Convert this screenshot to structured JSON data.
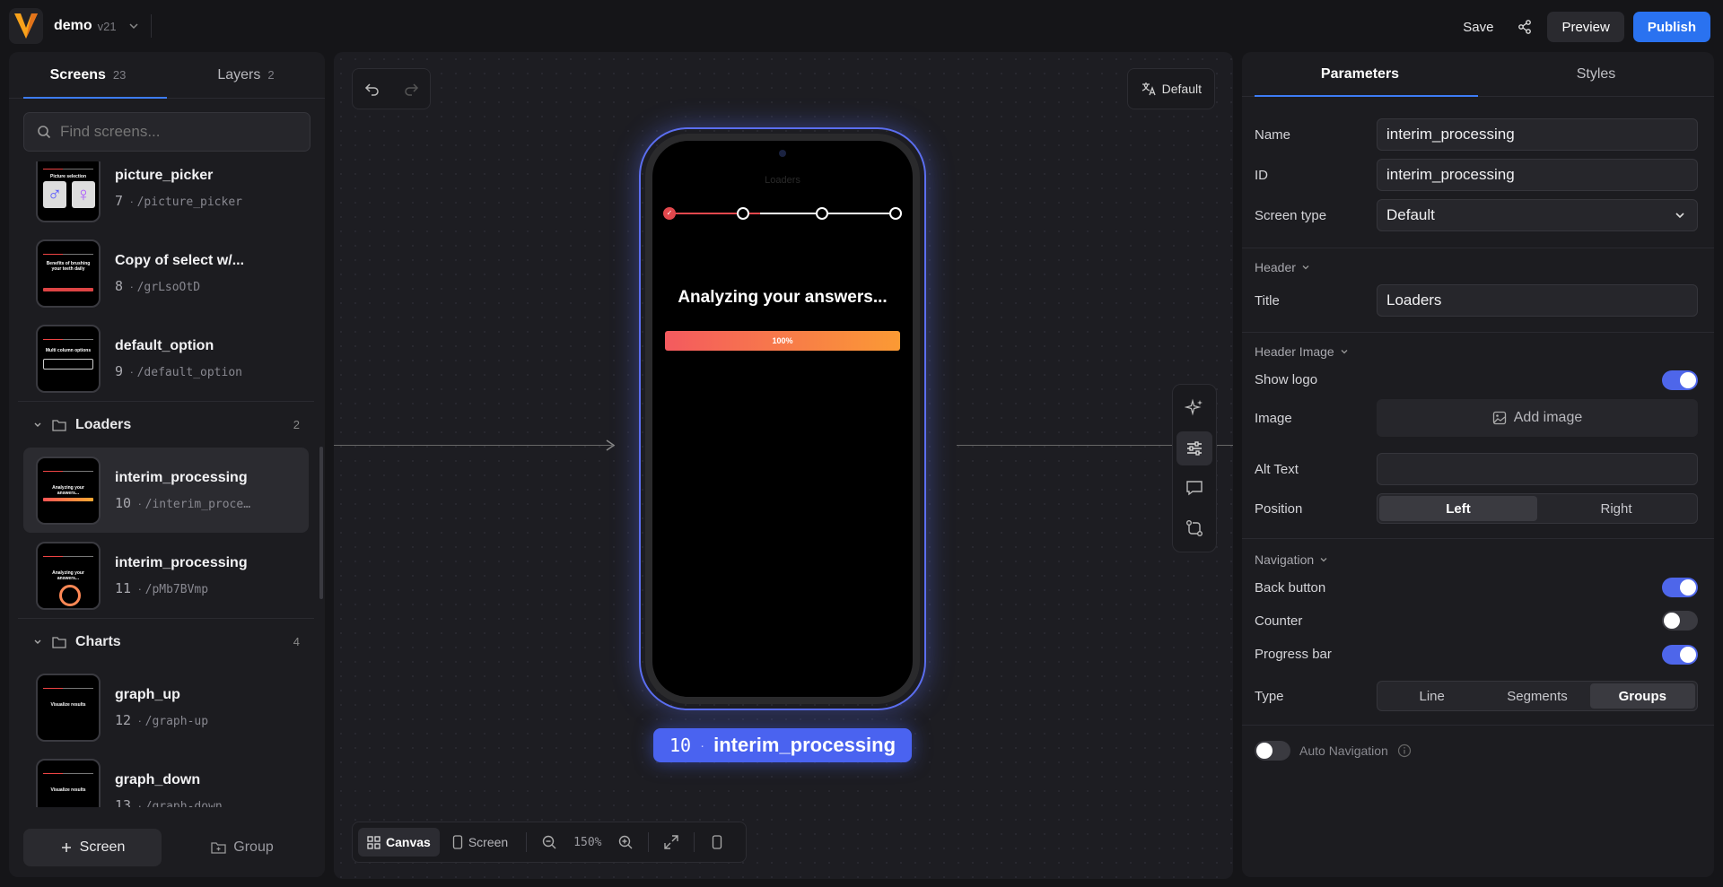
{
  "app": {
    "project_name": "demo",
    "version": "v21"
  },
  "toolbar": {
    "save_label": "Save",
    "preview_label": "Preview",
    "publish_label": "Publish"
  },
  "left": {
    "tabs": [
      {
        "label": "Screens",
        "count": "23"
      },
      {
        "label": "Layers",
        "count": "2"
      }
    ],
    "search_placeholder": "Find screens...",
    "items_top": [
      {
        "title": "picture_picker",
        "num": "7",
        "path": "/picture_picker",
        "thumb_title": "Picture selection"
      },
      {
        "title": "Copy of select w/...",
        "num": "8",
        "path": "/grLsoOtD",
        "thumb_title": "Benefits of brushing your teeth daily"
      },
      {
        "title": "default_option",
        "num": "9",
        "path": "/default_option",
        "thumb_title": "Multi column options"
      }
    ],
    "groups": [
      {
        "name": "Loaders",
        "count": "2",
        "items": [
          {
            "title": "interim_processing",
            "num": "10",
            "path": "/interim_proce…",
            "thumb_title": "Analyzing your answers..."
          },
          {
            "title": "interim_processing",
            "num": "11",
            "path": "/pMb7BVmp",
            "thumb_title": "Analyzing your answers..."
          }
        ]
      },
      {
        "name": "Charts",
        "count": "4",
        "items": [
          {
            "title": "graph_up",
            "num": "12",
            "path": "/graph-up",
            "thumb_title": "Visualize results"
          },
          {
            "title": "graph_down",
            "num": "13",
            "path": "/graph-down",
            "thumb_title": "Visualize results"
          }
        ]
      }
    ],
    "add_screen_label": "Screen",
    "add_group_label": "Group"
  },
  "canvas": {
    "language_label": "Default",
    "phone": {
      "header_title": "Loaders",
      "title": "Analyzing your answers...",
      "progress_text": "100%",
      "progress_value": 1.0
    },
    "screen_label": {
      "num": "10",
      "name": "interim_processing"
    },
    "bottom": {
      "canvas_label": "Canvas",
      "screen_label": "Screen",
      "zoom": "150%"
    }
  },
  "right": {
    "tabs": [
      "Parameters",
      "Styles"
    ],
    "name_label": "Name",
    "name_value": "interim_processing",
    "id_label": "ID",
    "id_value": "interim_processing",
    "screen_type_label": "Screen type",
    "screen_type_value": "Default",
    "header_section": "Header",
    "title_label": "Title",
    "title_value": "Loaders",
    "header_image_section": "Header Image",
    "show_logo_label": "Show logo",
    "image_label": "Image",
    "add_image_label": "Add image",
    "alt_text_label": "Alt Text",
    "position_label": "Position",
    "position_options": [
      "Left",
      "Right"
    ],
    "navigation_section": "Navigation",
    "back_button_label": "Back button",
    "counter_label": "Counter",
    "progress_bar_label": "Progress bar",
    "type_label": "Type",
    "type_options": [
      "Line",
      "Segments",
      "Groups"
    ],
    "auto_navigation_label": "Auto Navigation"
  }
}
